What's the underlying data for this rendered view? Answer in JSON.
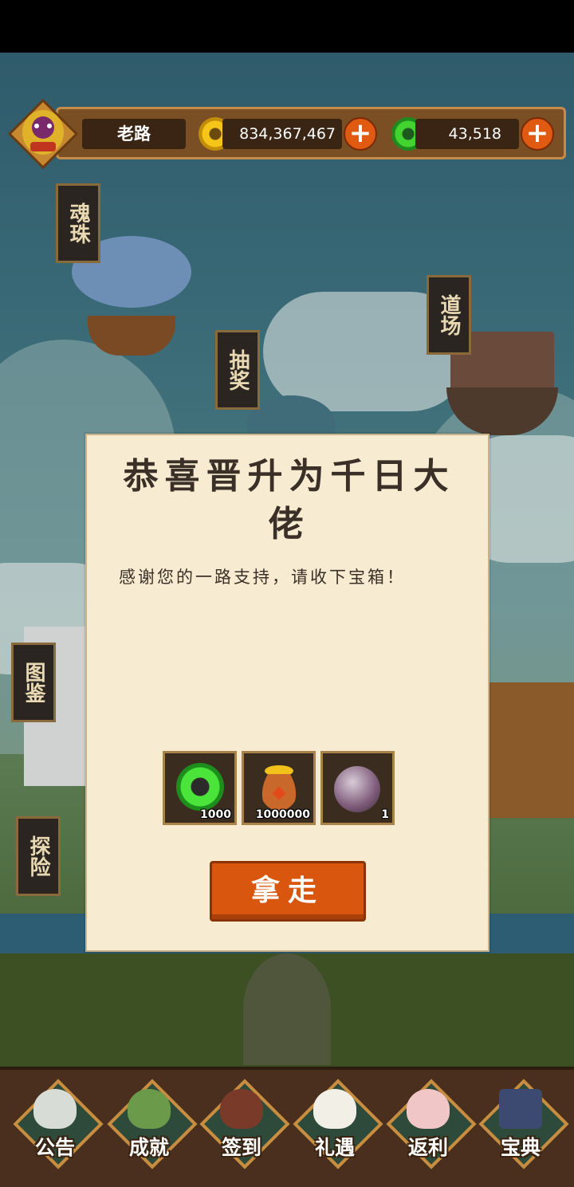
{
  "player": {
    "name": "老路",
    "gold": "834,367,467",
    "jade": "43,518",
    "plus_label": "+"
  },
  "scene_signs": [
    "魂珠",
    "道场",
    "抽奖",
    "图鉴",
    "探险"
  ],
  "dialog": {
    "title": "恭喜晋升为千日大佬",
    "message": "感谢您的一路支持，请收下宝箱！",
    "rewards": [
      {
        "icon": "jade-ring-icon",
        "quantity": "1000"
      },
      {
        "icon": "coin-bag-icon",
        "quantity": "1000000"
      },
      {
        "icon": "soul-orb-icon",
        "quantity": "1"
      }
    ],
    "button_label": "拿走"
  },
  "bottom_nav": [
    {
      "label": "公告",
      "icon": "shell-icon"
    },
    {
      "label": "成就",
      "icon": "toad-icon"
    },
    {
      "label": "签到",
      "icon": "shrine-icon"
    },
    {
      "label": "礼遇",
      "icon": "lucky-cat-icon"
    },
    {
      "label": "返利",
      "icon": "pig-icon"
    },
    {
      "label": "宝典",
      "icon": "book-icon"
    }
  ],
  "colors": {
    "accent": "#d9560f",
    "panel": "#f7ecd2",
    "bar": "#7a4f24"
  }
}
